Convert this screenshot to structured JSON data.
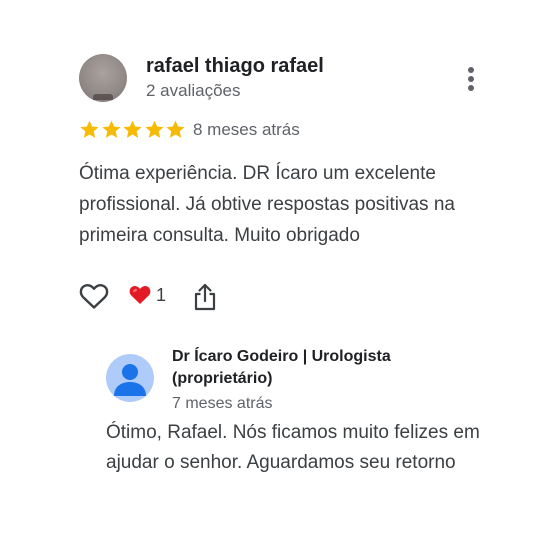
{
  "review": {
    "reviewer_name": "rafael thiago rafael",
    "reviewer_meta": "2 avaliações",
    "rating": 5,
    "time": "8 meses atrás",
    "text": "Ótima experiência. DR Ícaro um excelente profissional. Já obtive respostas positivas na primeira consulta. Muito obrigado",
    "reaction_count": "1",
    "icons": {
      "more": "more-vert-icon",
      "like": "heart-outline-icon",
      "reaction": "red-heart-emoji-icon",
      "share": "share-icon"
    }
  },
  "owner_response": {
    "name": "Dr Ícaro Godeiro | Urologista (proprietário)",
    "time": "7 meses atrás",
    "text": "Ótimo, Rafael. Nós ficamos muito felizes em ajudar o senhor. Aguardamos seu retorno"
  },
  "colors": {
    "star": "#F6BB06",
    "heart_reaction": "#E21B25",
    "owner_avatar_bg": "#AECBFA",
    "owner_avatar_fg": "#1A73E8",
    "secondary_text": "#5F6368"
  }
}
